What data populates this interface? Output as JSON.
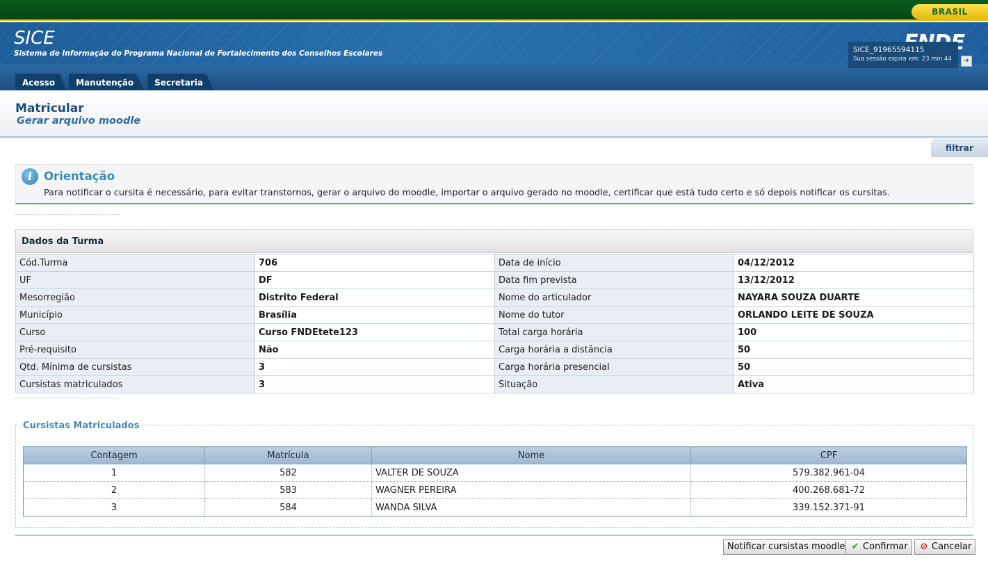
{
  "gov": {
    "brasil_label": "BRASIL"
  },
  "header": {
    "app_name": "SICE",
    "app_subtitle": "Sistema de Informação do Programa Nacional de Fortalecimento dos Conselhos Escolares",
    "brand": "FNDE",
    "tabs": [
      "Acesso",
      "Manutenção",
      "Secretaria"
    ],
    "session_id": "SICE_91965594115",
    "session_expires": "Sua sessão expira em: 23 min 44"
  },
  "page": {
    "title": "Matricular",
    "subtitle": "Gerar arquivo moodle",
    "filter_label": "filtrar"
  },
  "orientacao": {
    "title": "Orientação",
    "text": "Para notificar o cursita é necessário, para evitar transtornos, gerar o arquivo do moodle, importar o arquivo gerado no moodle, certificar que está tudo certo e só depois notificar os cursitas."
  },
  "dados": {
    "title": "Dados da Turma",
    "rows": [
      {
        "l1": "Cód.Turma",
        "v1": "706",
        "l2": "Data de início",
        "v2": "04/12/2012"
      },
      {
        "l1": "UF",
        "v1": "DF",
        "l2": "Data fim prevista",
        "v2": "13/12/2012"
      },
      {
        "l1": "Mesorregião",
        "v1": "Distrito Federal",
        "l2": "Nome do articulador",
        "v2": "NAYARA SOUZA DUARTE"
      },
      {
        "l1": "Município",
        "v1": "Brasília",
        "l2": "Nome do tutor",
        "v2": "ORLANDO LEITE DE SOUZA"
      },
      {
        "l1": "Curso",
        "v1": "Curso FNDEtete123",
        "l2": "Total carga horária",
        "v2": "100"
      },
      {
        "l1": "Pré-requisito",
        "v1": "Não",
        "l2": "Carga horária a distância",
        "v2": "50"
      },
      {
        "l1": "Qtd. Mínima de cursistas",
        "v1": "3",
        "l2": "Carga horária presencial",
        "v2": "50"
      },
      {
        "l1": "Cursistas matriculados",
        "v1": "3",
        "l2": "Situação",
        "v2": "Ativa"
      }
    ]
  },
  "cursistas": {
    "legend": "Cursistas Matriculados",
    "headers": [
      "Contagem",
      "Matrícula",
      "Nome",
      "CPF"
    ],
    "rows": [
      {
        "contagem": "1",
        "matricula": "582",
        "nome": "VALTER DE SOUZA",
        "cpf": "579.382.961-04"
      },
      {
        "contagem": "2",
        "matricula": "583",
        "nome": "WAGNER PEREIRA",
        "cpf": "400.268.681-72"
      },
      {
        "contagem": "3",
        "matricula": "584",
        "nome": "WANDA SILVA",
        "cpf": "339.152.371-91"
      }
    ]
  },
  "actions": {
    "notify_label": "Notificar cursistas moodle",
    "confirm_label": "Confirmar",
    "cancel_label": "Cancelar"
  }
}
